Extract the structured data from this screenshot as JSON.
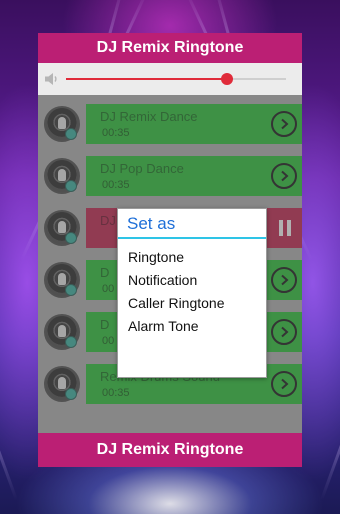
{
  "header": {
    "title": "DJ Remix Ringtone"
  },
  "player": {
    "progress": 0.73,
    "volume_icon": "volume-icon"
  },
  "songs": [
    {
      "title": "DJ Remix Dance",
      "duration": "00:35",
      "state": "play"
    },
    {
      "title": "DJ Pop Dance",
      "duration": "00:35",
      "state": "play"
    },
    {
      "title": "DJ",
      "duration": "",
      "state": "playing"
    },
    {
      "title": "D",
      "duration": "00",
      "state": "play"
    },
    {
      "title": "D",
      "duration": "00",
      "state": "play"
    },
    {
      "title": "Remix Drums Sound",
      "duration": "00:35",
      "state": "play"
    }
  ],
  "dialog": {
    "title": "Set as",
    "options": [
      "Ringtone",
      "Notification",
      "Caller Ringtone",
      "Alarm Tone"
    ]
  },
  "footer": {
    "title": "DJ Remix Ringtone"
  },
  "colors": {
    "accent": "#bb1f74",
    "card": "#1f9a2a",
    "card_active": "#9a1b3d",
    "seek": "#e02b3a",
    "dialog_title": "#1e6fd8"
  }
}
